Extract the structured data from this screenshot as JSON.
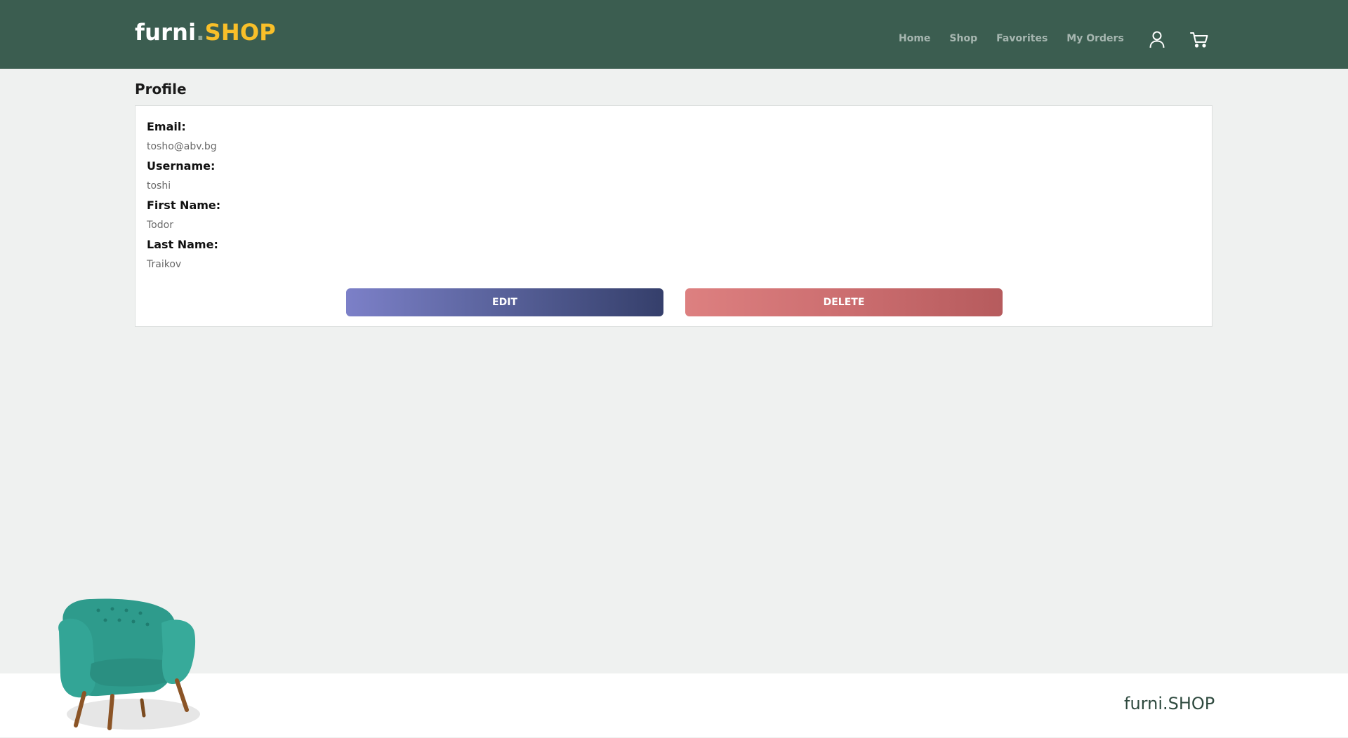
{
  "brand": {
    "logo_part1": "furni",
    "logo_dot": ".",
    "logo_part2": "SHOP",
    "color_primary": "#3b5d50",
    "color_accent": "#f9bf29"
  },
  "nav": {
    "links": [
      "Home",
      "Shop",
      "Favorites",
      "My Orders"
    ],
    "user_icon": "user-icon",
    "cart_icon": "cart-icon"
  },
  "profile": {
    "title": "Profile",
    "fields": [
      {
        "label": "Email:",
        "value": "tosho@abv.bg"
      },
      {
        "label": "Username:",
        "value": "toshi"
      },
      {
        "label": "First Name:",
        "value": "Todor"
      },
      {
        "label": "Last Name:",
        "value": "Traikov"
      }
    ],
    "edit_label": "EDIT",
    "delete_label": "DELETE"
  },
  "footer": {
    "logo": "furni.SHOP",
    "image_icon": "armchair-image"
  }
}
